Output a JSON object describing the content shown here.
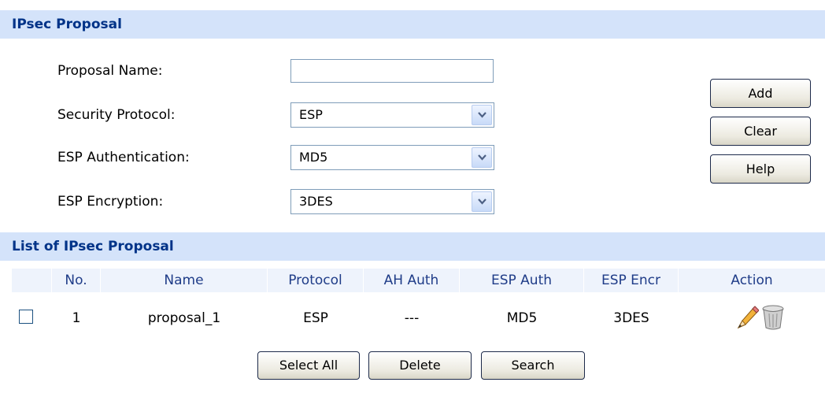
{
  "proposal_section": {
    "title": "IPsec Proposal",
    "fields": {
      "name_label": "Proposal Name:",
      "name_value": "",
      "protocol_label": "Security Protocol:",
      "protocol_value": "ESP",
      "auth_label": "ESP Authentication:",
      "auth_value": "MD5",
      "encryption_label": "ESP Encryption:",
      "encryption_value": "3DES"
    },
    "buttons": {
      "add": "Add",
      "clear": "Clear",
      "help": "Help"
    }
  },
  "list_section": {
    "title": "List of IPsec Proposal",
    "columns": [
      "No.",
      "Name",
      "Protocol",
      "AH Auth",
      "ESP Auth",
      "ESP Encr",
      "Action"
    ],
    "rows": [
      {
        "no": "1",
        "name": "proposal_1",
        "protocol": "ESP",
        "ah_auth": "---",
        "esp_auth": "MD5",
        "esp_encr": "3DES",
        "edit_icon": "pencil-icon",
        "delete_icon": "trash-icon"
      }
    ],
    "buttons": {
      "select_all": "Select All",
      "delete": "Delete",
      "search": "Search"
    }
  },
  "colors": {
    "header_bg": "#d4e3fa",
    "header_text": "#003388",
    "column_header_bg": "#eef3fc",
    "column_header_text": "#1f3c88"
  }
}
